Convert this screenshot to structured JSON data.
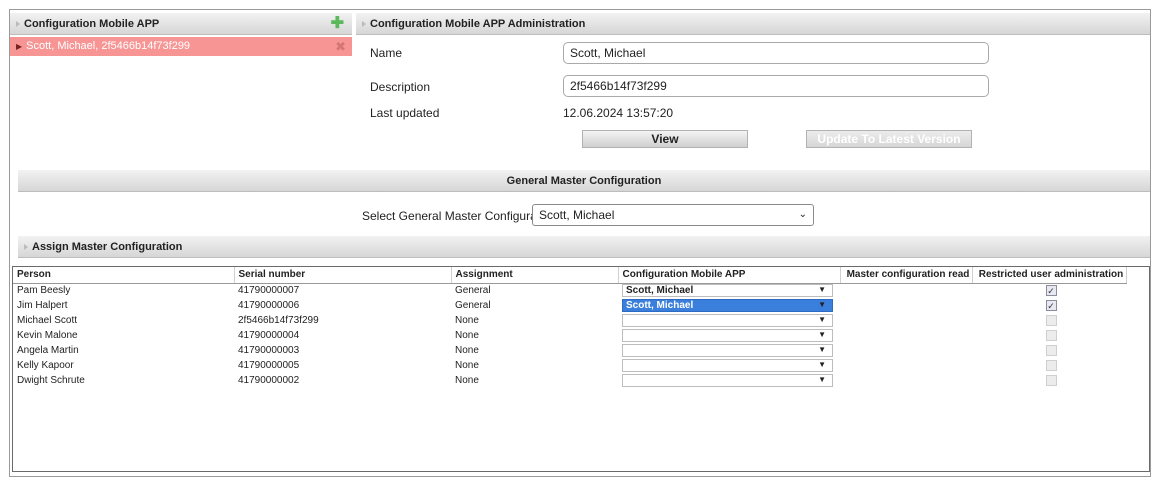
{
  "left_panel": {
    "title": "Configuration Mobile APP",
    "add_icon": "plus-icon",
    "selected_item": "Scott, Michael, 2f5466b14f73f299",
    "remove_icon": "close-icon"
  },
  "admin": {
    "title": "Configuration Mobile APP Administration",
    "name_label": "Name",
    "name_value": "Scott, Michael",
    "description_label": "Description",
    "description_value": "2f5466b14f73f299",
    "updated_label": "Last updated",
    "updated_value": "12.06.2024 13:57:20",
    "view_button": "View",
    "update_button": "Update To Latest Version"
  },
  "general": {
    "title": "General Master Configuration",
    "select_label": "Select General Master Configuration",
    "select_value": "Scott, Michael"
  },
  "assign": {
    "title": "Assign Master Configuration",
    "columns": [
      "Person",
      "Serial number",
      "Assignment",
      "Configuration Mobile APP",
      "Master configuration read",
      "Restricted user administration"
    ],
    "rows": [
      {
        "person": "Pam Beesly",
        "serial": "41790000007",
        "assignment": "General",
        "config": "Scott, Michael",
        "highlight": false,
        "restricted": true
      },
      {
        "person": "Jim Halpert",
        "serial": "41790000006",
        "assignment": "General",
        "config": "Scott, Michael",
        "highlight": true,
        "restricted": true
      },
      {
        "person": "Michael Scott",
        "serial": "2f5466b14f73f299",
        "assignment": "None",
        "config": "",
        "highlight": false,
        "restricted": false
      },
      {
        "person": "Kevin Malone",
        "serial": "41790000004",
        "assignment": "None",
        "config": "",
        "highlight": false,
        "restricted": false
      },
      {
        "person": "Angela Martin",
        "serial": "41790000003",
        "assignment": "None",
        "config": "",
        "highlight": false,
        "restricted": false
      },
      {
        "person": "Kelly Kapoor",
        "serial": "41790000005",
        "assignment": "None",
        "config": "",
        "highlight": false,
        "restricted": false
      },
      {
        "person": "Dwight Schrute",
        "serial": "41790000002",
        "assignment": "None",
        "config": "",
        "highlight": false,
        "restricted": false
      }
    ]
  },
  "colors": {
    "selected_row": "#f79595",
    "highlight_select": "#3b7fdc",
    "plus_icon": "#5cb85c"
  }
}
